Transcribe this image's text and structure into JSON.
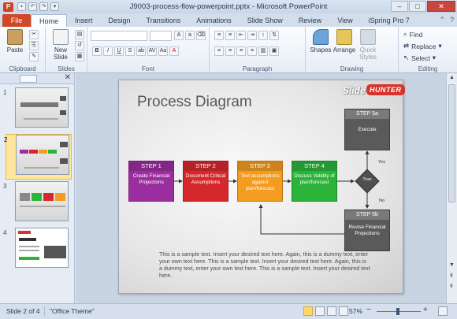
{
  "window": {
    "title": "J9003-process-flow-powerpoint.pptx - Microsoft PowerPoint",
    "app_icon": "P"
  },
  "tabs": {
    "file": "File",
    "items": [
      "Home",
      "Insert",
      "Design",
      "Transitions",
      "Animations",
      "Slide Show",
      "Review",
      "View",
      "iSpring Pro 7"
    ]
  },
  "ribbon": {
    "clipboard": {
      "label": "Clipboard",
      "paste": "Paste"
    },
    "slides": {
      "label": "Slides",
      "new_slide": "New Slide"
    },
    "font": {
      "label": "Font"
    },
    "paragraph": {
      "label": "Paragraph"
    },
    "drawing": {
      "label": "Drawing",
      "shapes": "Shapes",
      "arrange": "Arrange",
      "quick_styles": "Quick Styles"
    },
    "editing": {
      "label": "Editing",
      "find": "Find",
      "replace": "Replace",
      "select": "Select"
    }
  },
  "slide": {
    "title": "Process Diagram",
    "logo_slide": "Slide",
    "logo_hunter": "HUNTER",
    "steps": [
      {
        "header": "STEP 1",
        "body": "Create Financial Projections",
        "color": "#9b2e9e"
      },
      {
        "header": "STEP 2",
        "body": "Document Critical Assumptions",
        "color": "#d5282c"
      },
      {
        "header": "STEP 3",
        "body": "Test assumptions against plan/forecast",
        "color": "#f39c1f"
      },
      {
        "header": "STEP 4",
        "body": "Discuss Validity of plan/forecast",
        "color": "#2bb33a"
      }
    ],
    "step5a": {
      "header": "STEP 5a",
      "body": "Execute"
    },
    "step5b": {
      "header": "STEP 5b",
      "body": "Revise Financial Projections"
    },
    "decision": "True",
    "yes": "Yes",
    "no": "No",
    "sample_text": "This is a sample text. Insert your desired text here. Again, this is a dummy text, enter your own text here. This is a sample text. Insert your desired text here. Again, this is a dummy text, enter your own text here. This is a sample text. Insert your desired text here."
  },
  "thumbnails": [
    {
      "num": "1"
    },
    {
      "num": "2"
    },
    {
      "num": "3"
    },
    {
      "num": "4"
    }
  ],
  "status": {
    "slide_info": "Slide 2 of 4",
    "theme": "\"Office Theme\"",
    "zoom": "57%"
  }
}
